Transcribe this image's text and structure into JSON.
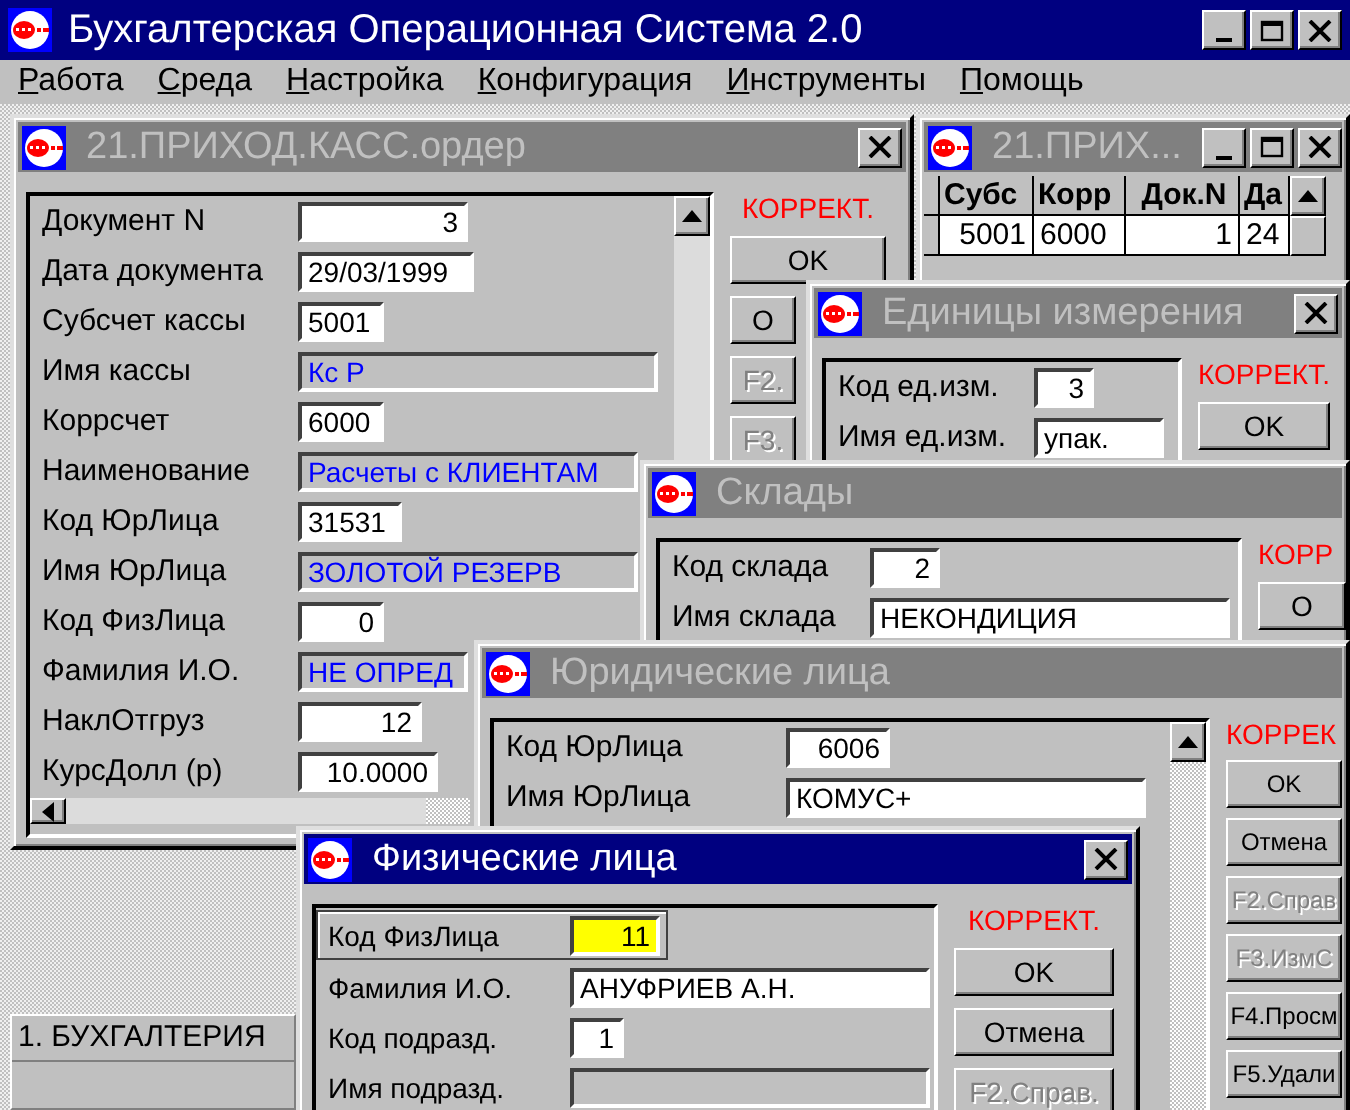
{
  "app": {
    "title": "Бухгалтерская Операционная Система 2.0"
  },
  "menu": [
    {
      "label": "Работа"
    },
    {
      "label": "Среда"
    },
    {
      "label": "Настройка"
    },
    {
      "label": "Конфигурация"
    },
    {
      "label": "Инструменты"
    },
    {
      "label": "Помощь"
    }
  ],
  "windows": [
    {
      "kind": "form",
      "title": "21.ПРИХОД.КАСС.ордер",
      "active": false,
      "fields": [
        {
          "label": "Документ N",
          "value": "3",
          "kind": "number",
          "focused": false
        },
        {
          "label": "Дата документа",
          "value": "29/03/1999",
          "kind": "text",
          "focused": false
        },
        {
          "label": "Субсчет кассы",
          "value": "5001",
          "kind": "text",
          "focused": false
        },
        {
          "label": "Имя кассы",
          "value": "Кс Р",
          "kind": "lookup",
          "focused": false
        },
        {
          "label": "Коррсчет",
          "value": "6000",
          "kind": "text",
          "focused": false
        },
        {
          "label": "Наименование",
          "value": "Расчеты с КЛИЕНТАМ",
          "kind": "lookup",
          "focused": false
        },
        {
          "label": "Код ЮрЛица",
          "value": "31531",
          "kind": "text",
          "focused": false
        },
        {
          "label": "Имя ЮрЛица",
          "value": "ЗОЛОТОЙ РЕЗЕРВ",
          "kind": "lookup",
          "focused": false
        },
        {
          "label": "Код ФизЛица",
          "value": "0",
          "kind": "number",
          "focused": false
        },
        {
          "label": "Фамилия И.О.",
          "value": "НЕ ОПРЕД",
          "kind": "lookup",
          "focused": false
        },
        {
          "label": "НаклОтгруз",
          "value": "12",
          "kind": "number",
          "focused": false
        },
        {
          "label": "КурсДолл  (р)",
          "value": "10.0000",
          "kind": "number",
          "focused": false
        }
      ],
      "mode": "КОРРЕКТ.",
      "buttons": [
        {
          "label": "OK",
          "disabled": false
        },
        {
          "label": "О",
          "disabled": false
        },
        {
          "label": "F2.",
          "disabled": true
        },
        {
          "label": "F3.",
          "disabled": true
        }
      ]
    },
    {
      "kind": "grid",
      "title": "21.ПРИХ...",
      "active": false,
      "columns": [
        "Субс",
        "Корр",
        "Док.N",
        "Да"
      ],
      "rows": [
        [
          "5001",
          "6000",
          "1",
          "24"
        ]
      ]
    },
    {
      "kind": "form",
      "title": "Единицы измерения",
      "active": false,
      "fields": [
        {
          "label": "Код ед.изм.",
          "value": "3",
          "kind": "number",
          "focused": false
        },
        {
          "label": "Имя ед.изм.",
          "value": "упак.",
          "kind": "text",
          "focused": false
        }
      ],
      "mode": "КОРРЕКТ.",
      "buttons": [
        {
          "label": "OK",
          "disabled": false
        }
      ]
    },
    {
      "kind": "form",
      "title": "Склады",
      "active": false,
      "fields": [
        {
          "label": "Код склада",
          "value": "2",
          "kind": "number",
          "focused": false
        },
        {
          "label": "Имя склада",
          "value": "НЕКОНДИЦИЯ",
          "kind": "text",
          "focused": false
        }
      ],
      "mode": "КОРР",
      "buttons": [
        {
          "label": "О",
          "disabled": false
        }
      ]
    },
    {
      "kind": "form",
      "title": "Юридические лица",
      "active": false,
      "fields": [
        {
          "label": "Код ЮрЛица",
          "value": "6006",
          "kind": "number",
          "focused": false
        },
        {
          "label": "Имя ЮрЛица",
          "value": "КОМУС+",
          "kind": "text",
          "focused": false
        }
      ],
      "mode": "КОРРЕК",
      "buttons": [
        {
          "label": "OK",
          "disabled": false
        },
        {
          "label": "Отмена",
          "disabled": false
        },
        {
          "label": "F2.Справ",
          "disabled": true
        },
        {
          "label": "F3.ИзмС",
          "disabled": true
        },
        {
          "label": "F4.Просм",
          "disabled": false
        },
        {
          "label": "F5.Удали",
          "disabled": false
        }
      ]
    },
    {
      "kind": "form",
      "title": "Физические лица",
      "active": true,
      "fields": [
        {
          "label": "Код ФизЛица",
          "value": "11",
          "kind": "number",
          "focused": true
        },
        {
          "label": "Фамилия И.О.",
          "value": "АНУФРИЕВ А.Н.",
          "kind": "text",
          "focused": false
        },
        {
          "label": "Код подразд.",
          "value": "1",
          "kind": "number",
          "focused": false
        },
        {
          "label": "Имя подразд.",
          "kind": "lookup",
          "focused": false
        }
      ],
      "mode": "КОРРЕКТ.",
      "buttons": [
        {
          "label": "OK",
          "disabled": false
        },
        {
          "label": "Отмена",
          "disabled": false
        },
        {
          "label": "F2.Справ.",
          "disabled": true
        }
      ]
    }
  ],
  "minimized": [
    {
      "title": "1. БУХГАЛТЕРИЯ"
    }
  ]
}
